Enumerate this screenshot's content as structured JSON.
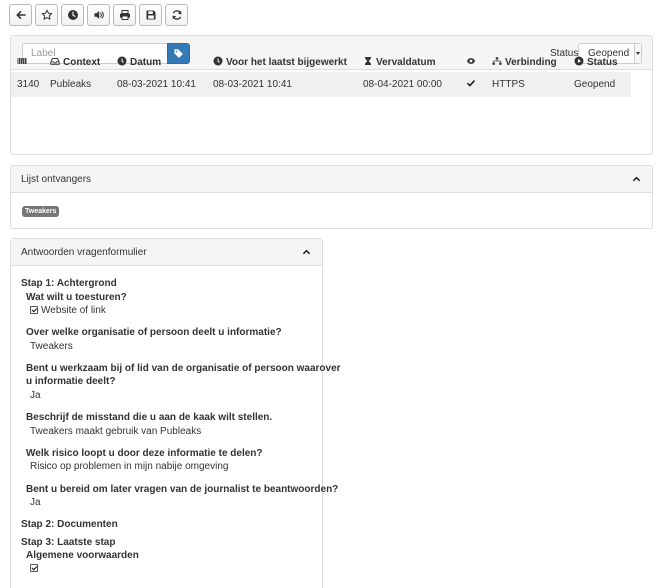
{
  "toolbar": {
    "buttons": [
      {
        "icon": "arrow-left-icon",
        "name": "back-button"
      },
      {
        "icon": "star-icon",
        "name": "star-button"
      },
      {
        "icon": "clock-icon",
        "name": "postpone-button"
      },
      {
        "icon": "volume-icon",
        "name": "silence-button"
      },
      {
        "icon": "print-icon",
        "name": "print-button"
      },
      {
        "icon": "save-icon",
        "name": "save-button"
      },
      {
        "icon": "refresh-icon",
        "name": "refresh-button"
      }
    ]
  },
  "tip": {
    "label_placeholder": "Label",
    "status_label": "Status:",
    "status_value": "Geopend",
    "columns": {
      "id_icon": "barcode-icon",
      "context": "Context",
      "datum": "Datum",
      "updated": "Voor het laatst bijgewerkt",
      "expiry": "Vervaldatum",
      "seen_icon": "eye-icon",
      "connection": "Verbinding",
      "status": "Status"
    },
    "row": {
      "id": "3140",
      "context": "Publeaks",
      "datum": "08-03-2021 10:41",
      "updated": "08-03-2021 10:41",
      "expiry": "08-04-2021 00:00",
      "seen": "checkmark-icon",
      "connection": "HTTPS",
      "status": "Geopend"
    }
  },
  "recipients": {
    "title": "Lijst ontvangers",
    "items": [
      "Tweakers"
    ]
  },
  "answers": {
    "title": "Antwoorden vragenformulier",
    "step1": "Stap 1: Achtergrond",
    "q1": "Wat wilt u toesturen?",
    "a1": "Website of link",
    "q2": "Over welke organisatie of persoon deelt u informatie?",
    "a2": "Tweakers",
    "q3_line1": "Bent u werkzaam bij of lid van de organisatie of persoon waarover",
    "q3_line2": "u informatie deelt?",
    "a3": "Ja",
    "q4": "Beschrijf de misstand die u aan de kaak wilt stellen.",
    "a4": "Tweakers maakt gebruik van Publeaks",
    "q5": "Welk risico loopt u door deze informatie te delen?",
    "a5": "Risico op problemen in mijn nabije omgeving",
    "q6": "Bent u bereid om later vragen van de journalist te beantwoorden?",
    "a6": "Ja",
    "step2": "Stap 2: Documenten",
    "step3": "Stap 3: Laatste stap",
    "q7": "Algemene voorwaarden"
  }
}
